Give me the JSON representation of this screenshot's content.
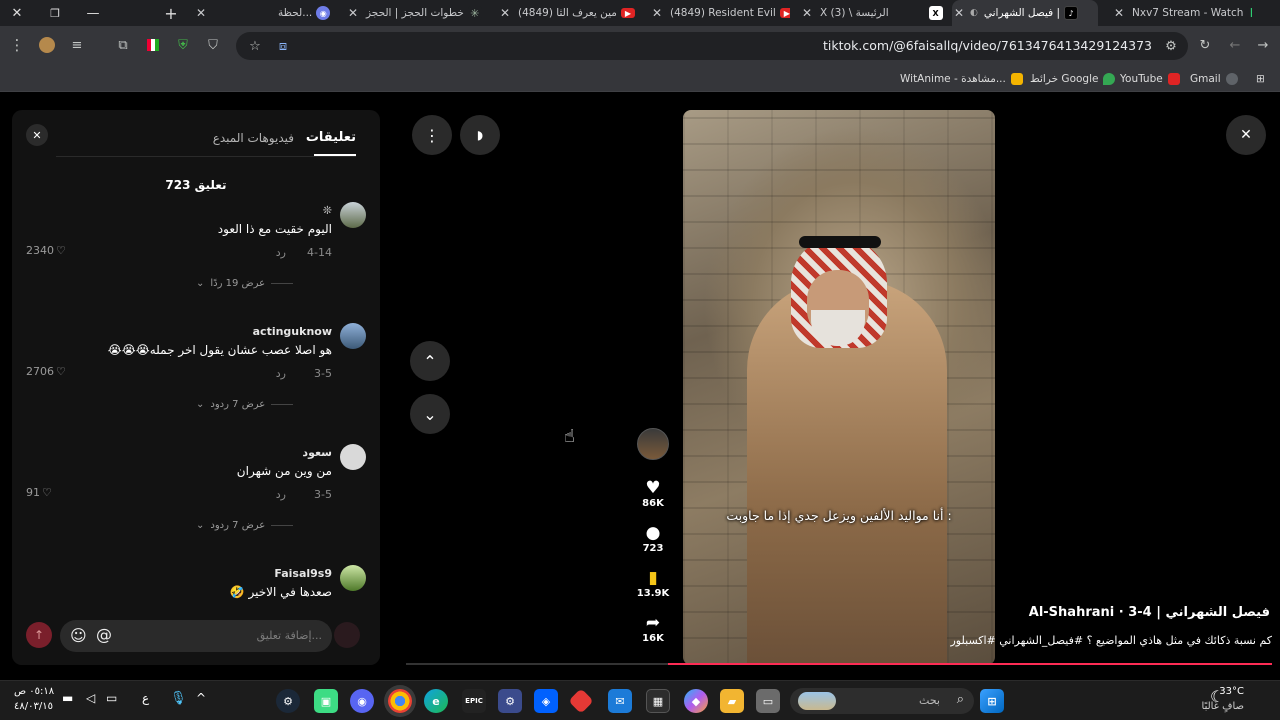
{
  "browser": {
    "tabs": [
      {
        "title": "Nxv7 Stream - Watch",
        "fav_color": "#2ecc71",
        "fav_glyph": "K"
      },
      {
        "title": "فيصل الشهراني |",
        "fav_color": "#111111",
        "fav_glyph": "♪",
        "active": true
      },
      {
        "title": "الرئيسة \\ (3) X",
        "fav_color": "#000000",
        "fav_glyph": "X"
      },
      {
        "title": "(4849) Resident Evil",
        "fav_color": "#e02424",
        "fav_glyph": "▶"
      },
      {
        "title": "(4849) مين يعرف الثا",
        "fav_color": "#e02424",
        "fav_glyph": "▶"
      },
      {
        "title": "خطوات الحجز | الحجز",
        "fav_color": "#3c4a3e",
        "fav_glyph": "✳"
      },
      {
        "title": "لحظة...",
        "fav_color": "#6f7de8",
        "fav_glyph": "◉"
      }
    ],
    "url": "tiktok.com/@6faisallq/video/7613476413429124373",
    "bookmarks": [
      {
        "label": "Gmail",
        "color": "#5f6368"
      },
      {
        "label": "YouTube",
        "color": "#e02424"
      },
      {
        "label": "خرائط Google",
        "color": "#34a853"
      },
      {
        "label": "WitAnime - مشاهدة...",
        "color": "#f4b400"
      }
    ]
  },
  "comments_panel": {
    "tabs": {
      "comments": "تعليقات",
      "creator_videos": "فيديوهات المبدع"
    },
    "count_label": "723 تعليق",
    "comments": [
      {
        "user": "❊",
        "text": "اليوم خقيت مع ذا العود",
        "date": "4-14",
        "reply": "رد",
        "likes": "2340",
        "view_replies": "عرض 19 ردًا",
        "avatar_color": "#5e6b4a"
      },
      {
        "user": "actinguknow",
        "text": "هو اصلا عصب عشان يقول اخر جمله😭😭😭",
        "date": "3-5",
        "reply": "رد",
        "likes": "2706",
        "view_replies": "عرض 7 ردود",
        "avatar_color": "#6f8fb5"
      },
      {
        "user": "سعود",
        "text": "من وين من شهران",
        "date": "3-5",
        "reply": "رد",
        "likes": "91",
        "view_replies": "عرض 7 ردود",
        "avatar_color": "#d9d9d9"
      },
      {
        "user": "Faisal9s9",
        "text": "صعدها في الاخير 🤣",
        "date": "",
        "reply": "",
        "likes": "",
        "view_replies": "",
        "avatar_color": "#7aa34a"
      }
    ],
    "input_placeholder": "إضافة تعليق...",
    "at_symbol": "@"
  },
  "video": {
    "subtitle": "أنا مواليد الألفين ويزعل جدي إذا ما جاوبت :",
    "author_line": "فيصل الشهراني | Al-Shahrani · 3-4",
    "caption": "كم نسبة ذكائك في مثل هاذي المواضيع ؟ #فيصل_الشهراني #اكسبلور",
    "likes": "86K",
    "comments": "723",
    "saves": "13.9K",
    "shares": "16K"
  },
  "taskbar": {
    "weather_temp": "33°C",
    "weather_desc": "صافٍ غالبًا",
    "search_placeholder": "بحث",
    "time": "٠٥:١٨ ص",
    "date": "٤٨/٠٣/١٥",
    "lang": "ع"
  }
}
